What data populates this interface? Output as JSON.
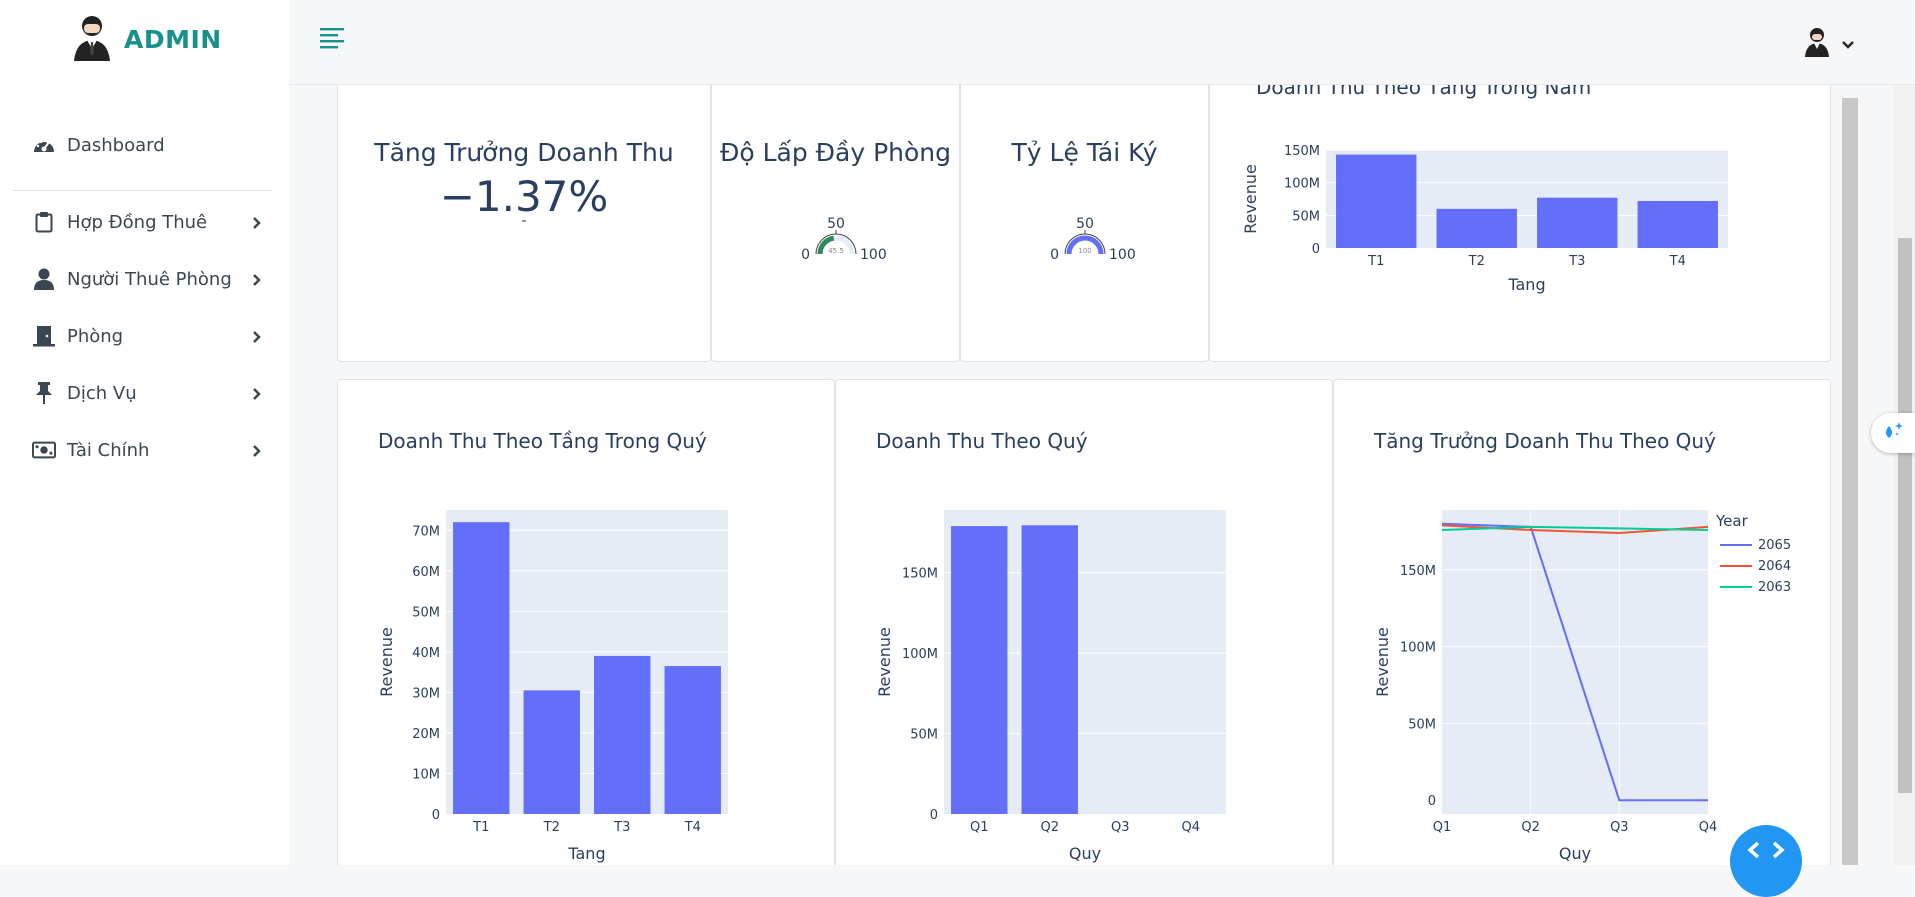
{
  "brand": {
    "name": "ADMIN"
  },
  "sidebar": {
    "items": [
      {
        "label": "Dashboard",
        "icon": "dashboard-gauge-icon"
      },
      {
        "label": "Hợp Đồng Thuê",
        "icon": "clipboard-icon"
      },
      {
        "label": "Người Thuê Phòng",
        "icon": "user-icon"
      },
      {
        "label": "Phòng",
        "icon": "door-icon"
      },
      {
        "label": "Dịch Vụ",
        "icon": "pin-icon"
      },
      {
        "label": "Tài Chính",
        "icon": "money-icon"
      }
    ]
  },
  "kpis": {
    "growth": {
      "title": "Tăng Trưởng Doanh Thu",
      "value": "−1.37%",
      "sub": "-"
    },
    "occupancy": {
      "title": "Độ Lấp Đầy Phòng",
      "value": "45.5",
      "min": "0",
      "mid": "50",
      "max": "100",
      "color": "#2e8b57"
    },
    "renewal": {
      "title": "Tỷ Lệ Tái Ký",
      "value": "100",
      "min": "0",
      "mid": "50",
      "max": "100",
      "color": "#636efa"
    }
  },
  "colors": {
    "accent": "#17918a",
    "bar": "#636efa",
    "plot_bg": "#e5ecf6",
    "text": "#2a3f5f",
    "line_2065": "#636efa",
    "line_2064": "#ef553b",
    "line_2063": "#00cc96"
  },
  "chart_data": [
    {
      "type": "bar",
      "title": "Doanh Thu Theo Tầng Trong Năm",
      "categories": [
        "T1",
        "T2",
        "T3",
        "T4"
      ],
      "values": [
        143000000,
        60000000,
        77000000,
        72000000
      ],
      "xlabel": "Tang",
      "ylabel": "Revenue",
      "ylim": [
        0,
        150000000
      ],
      "ticks": [
        0,
        50000000,
        100000000,
        150000000
      ],
      "tick_labels": [
        "0",
        "50M",
        "100M",
        "150M"
      ],
      "grid": true
    },
    {
      "type": "bar",
      "title": "Doanh Thu Theo Tầng Trong Quý",
      "categories": [
        "T1",
        "T2",
        "T3",
        "T4"
      ],
      "values": [
        72000000,
        30500000,
        39000000,
        36500000
      ],
      "xlabel": "Tang",
      "ylabel": "Revenue",
      "ylim": [
        0,
        75000000
      ],
      "ticks": [
        0,
        10000000,
        20000000,
        30000000,
        40000000,
        50000000,
        60000000,
        70000000
      ],
      "tick_labels": [
        "0",
        "10M",
        "20M",
        "30M",
        "40M",
        "50M",
        "60M",
        "70M"
      ],
      "grid": true
    },
    {
      "type": "bar",
      "title": "Doanh Thu Theo Quý",
      "categories": [
        "Q1",
        "Q2",
        "Q3",
        "Q4"
      ],
      "values": [
        179000000,
        179500000,
        0,
        0
      ],
      "xlabel": "Quy",
      "ylabel": "Revenue",
      "ylim": [
        0,
        189000000
      ],
      "ticks": [
        0,
        50000000,
        100000000,
        150000000
      ],
      "tick_labels": [
        "0",
        "50M",
        "100M",
        "150M"
      ],
      "grid": true
    },
    {
      "type": "line",
      "title": "Tăng Trưởng Doanh Thu Theo Quý",
      "x": [
        "Q1",
        "Q2",
        "Q3",
        "Q4"
      ],
      "xlabel": "Quy",
      "ylabel": "Revenue",
      "ylim": [
        -9000000,
        189000000
      ],
      "ticks": [
        0,
        50000000,
        100000000,
        150000000
      ],
      "tick_labels": [
        "0",
        "50M",
        "100M",
        "150M"
      ],
      "legend_title": "Year",
      "legend_position": "top-right",
      "grid": true,
      "series": [
        {
          "name": "2065",
          "values": [
            180000000,
            178000000,
            0,
            0
          ]
        },
        {
          "name": "2064",
          "values": [
            179000000,
            176000000,
            174000000,
            178000000
          ]
        },
        {
          "name": "2063",
          "values": [
            176000000,
            178000000,
            177000000,
            176000000
          ]
        }
      ]
    }
  ]
}
